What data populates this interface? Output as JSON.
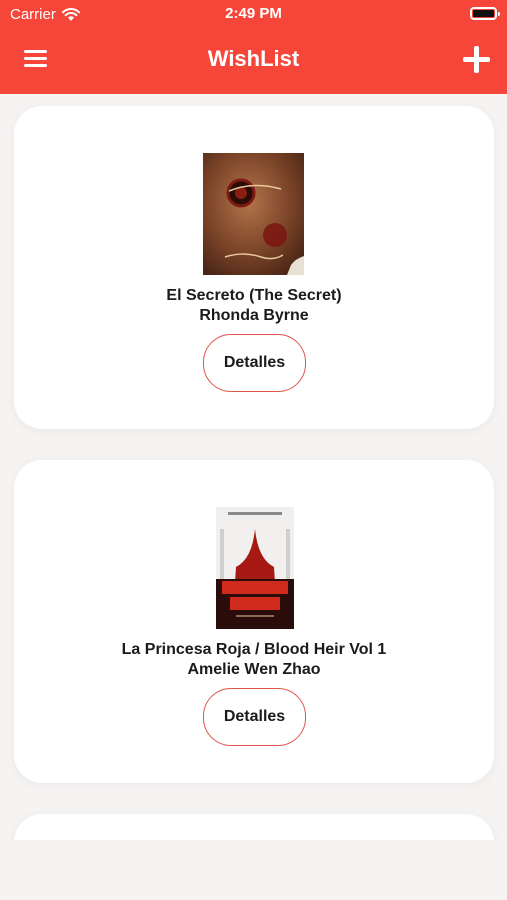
{
  "status_bar": {
    "carrier": "Carrier",
    "time": "2:49 PM"
  },
  "nav": {
    "title": "WishList",
    "menu_icon": "hamburger-menu-icon",
    "add_icon": "plus-icon"
  },
  "accent_color": "#f6463a",
  "books": [
    {
      "title": "El Secreto (The Secret)",
      "author": "Rhonda Byrne",
      "button": "Detalles"
    },
    {
      "title": "La Princesa Roja / Blood Heir Vol 1",
      "author": "Amelie Wen Zhao",
      "button": "Detalles"
    }
  ]
}
